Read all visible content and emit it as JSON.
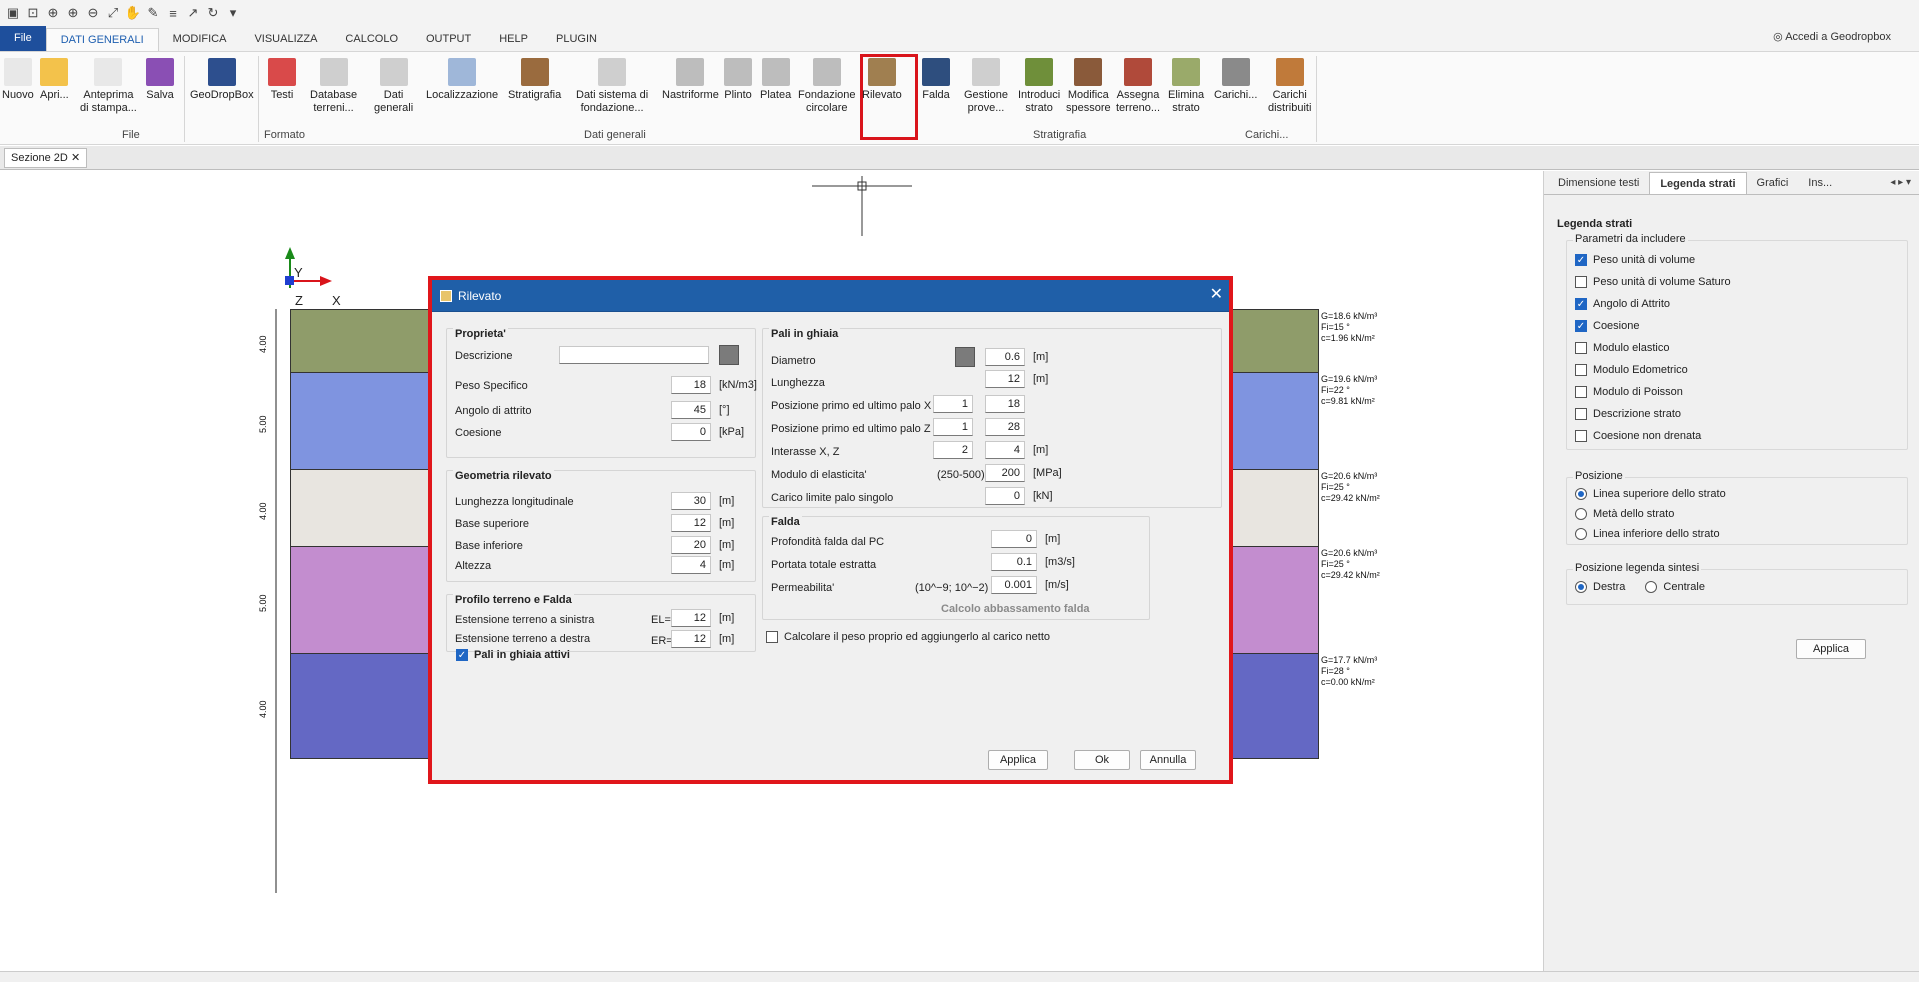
{
  "ribbon_tabs": [
    "File",
    "DATI GENERALI",
    "MODIFICA",
    "VISUALIZZA",
    "CALCOLO",
    "OUTPUT",
    "HELP",
    "PLUGIN"
  ],
  "account": "Accedi a Geodropbox",
  "ribbon_buttons": [
    {
      "label": "Nuovo",
      "color": "#e8e8e8"
    },
    {
      "label": "Apri...",
      "color": "#f3c24b"
    },
    {
      "label": "Anteprima\ndi stampa...",
      "color": "#e8e8e8"
    },
    {
      "label": "Salva",
      "color": "#8a4fb4"
    },
    {
      "label": "GeoDropBox",
      "color": "#2d4f8e"
    },
    {
      "label": "Testi",
      "color": "#d94a4a"
    },
    {
      "label": "Database\nterreni...",
      "color": "#cfcfcf"
    },
    {
      "label": "Dati\ngenerali",
      "color": "#cfcfcf"
    },
    {
      "label": "Localizzazione",
      "color": "#9fb7d9"
    },
    {
      "label": "Stratigrafia",
      "color": "#9a6b3e"
    },
    {
      "label": "Dati sistema di\nfondazione...",
      "color": "#cfcfcf"
    },
    {
      "label": "Nastriforme",
      "color": "#bdbdbd"
    },
    {
      "label": "Plinto",
      "color": "#bdbdbd"
    },
    {
      "label": "Platea",
      "color": "#bdbdbd"
    },
    {
      "label": "Fondazione\ncircolare",
      "color": "#bdbdbd"
    },
    {
      "label": "Rilevato",
      "color": "#a07f50"
    },
    {
      "label": "Falda",
      "color": "#2e4e7e"
    },
    {
      "label": "Gestione\nprove...",
      "color": "#cfcfcf"
    },
    {
      "label": "Introduci\nstrato",
      "color": "#6f8f3a"
    },
    {
      "label": "Modifica\nspessore",
      "color": "#8a5a3a"
    },
    {
      "label": "Assegna\nterreno...",
      "color": "#b04a3a"
    },
    {
      "label": "Elimina\nstrato",
      "color": "#9aaa6a"
    },
    {
      "label": "Carichi...",
      "color": "#8a8a8a"
    },
    {
      "label": "Carichi\ndistribuiti",
      "color": "#c07a3a"
    }
  ],
  "ribbon_groups": [
    "File",
    "Formato",
    "Dati generali",
    "Stratigrafia",
    "Carichi..."
  ],
  "doc_tab": "Sezione 2D",
  "axes": {
    "y": "Y",
    "z": "Z",
    "x": "X"
  },
  "layers": [
    {
      "thickness": "4.00",
      "color": "#8f9c6a",
      "label": "G=18.6 kN/m³\nFi=15 °\nc=1.96 kN/m²"
    },
    {
      "thickness": "5.00",
      "color": "#7f94e0",
      "label": "G=19.6 kN/m³\nFi=22 °\nc=9.81 kN/m²"
    },
    {
      "thickness": "4.00",
      "color": "#e8e5e0",
      "label": "G=20.6 kN/m³\nFi=25 °\nc=29.42 kN/m²"
    },
    {
      "thickness": "5.00",
      "color": "#c38dcf",
      "label": "G=20.6 kN/m³\nFi=25 °\nc=29.42 kN/m²"
    },
    {
      "thickness": "4.00",
      "color": "#6468c4",
      "label": "G=17.7 kN/m³\nFi=28 °\nc=0.00 kN/m²"
    }
  ],
  "side": {
    "tabs": [
      "Dimensione testi",
      "Legenda strati",
      "Grafici",
      "Ins..."
    ],
    "title": "Legenda strati",
    "params_title": "Parametri da includere",
    "params": [
      {
        "label": "Peso unità di volume",
        "checked": true
      },
      {
        "label": "Peso unità di volume Saturo",
        "checked": false
      },
      {
        "label": "Angolo di Attrito",
        "checked": true
      },
      {
        "label": "Coesione",
        "checked": true
      },
      {
        "label": "Modulo elastico",
        "checked": false
      },
      {
        "label": "Modulo Edometrico",
        "checked": false
      },
      {
        "label": "Modulo di Poisson",
        "checked": false
      },
      {
        "label": "Descrizione strato",
        "checked": false
      },
      {
        "label": "Coesione non drenata",
        "checked": false
      }
    ],
    "position_title": "Posizione",
    "positions": [
      {
        "label": "Linea superiore dello strato",
        "selected": true
      },
      {
        "label": "Metà dello strato",
        "selected": false
      },
      {
        "label": "Linea inferiore dello strato",
        "selected": false
      }
    ],
    "synth_title": "Posizione legenda sintesi",
    "synth": [
      {
        "label": "Destra",
        "selected": true
      },
      {
        "label": "Centrale",
        "selected": false
      }
    ],
    "apply": "Applica"
  },
  "dialog": {
    "title": "Rilevato",
    "props": {
      "title": "Proprieta'",
      "descr_label": "Descrizione",
      "descr_value": "",
      "peso_label": "Peso Specifico",
      "peso": "18",
      "peso_unit": "[kN/m3]",
      "attrito_label": "Angolo di attrito",
      "attrito": "45",
      "attrito_unit": "[°]",
      "coes_label": "Coesione",
      "coes": "0",
      "coes_unit": "[kPa]"
    },
    "geom": {
      "title": "Geometria rilevato",
      "l_label": "Lunghezza longitudinale",
      "l": "30",
      "bs_label": "Base superiore",
      "bs": "12",
      "bi_label": "Base inferiore",
      "bi": "20",
      "h_label": "Altezza",
      "h": "4",
      "unit": "[m]"
    },
    "profilo": {
      "title": "Profilo terreno e Falda",
      "sx_label": "Estensione terreno a sinistra",
      "el": "EL=",
      "sx": "12",
      "dx_label": "Estensione terreno a destra",
      "er": "ER=",
      "dx": "12",
      "unit": "[m]"
    },
    "pali_attivi": "Pali in ghiaia attivi",
    "pali": {
      "title": "Pali in ghiaia",
      "diam_label": "Diametro",
      "diam": "0.6",
      "lung_label": "Lunghezza",
      "lung": "12",
      "px_label": "Posizione primo ed ultimo palo X",
      "px1": "1",
      "px2": "18",
      "pz_label": "Posizione primo ed ultimo palo Z",
      "pz1": "1",
      "pz2": "28",
      "int_label": "Interasse X, Z",
      "int1": "2",
      "int2": "4",
      "mod_label": "Modulo di elasticita'",
      "mod_range": "(250-500)",
      "mod": "200",
      "mod_unit": "[MPa]",
      "car_label": "Carico limite palo singolo",
      "car": "0",
      "car_unit": "[kN]",
      "unit": "[m]"
    },
    "falda": {
      "title": "Falda",
      "prof_label": "Profondità falda dal PC",
      "prof": "0",
      "prof_unit": "[m]",
      "port_label": "Portata totale estratta",
      "port": "0.1",
      "port_unit": "[m3/s]",
      "perm_label": "Permeabilita'",
      "perm_range": "(10^−9; 10^−2)",
      "perm": "0.001",
      "perm_unit": "[m/s]",
      "calc": "Calcolo abbassamento falda"
    },
    "peso_proprio": "Calcolare il peso proprio ed aggiungerlo al carico netto",
    "buttons": {
      "apply": "Applica",
      "ok": "Ok",
      "cancel": "Annulla"
    }
  }
}
